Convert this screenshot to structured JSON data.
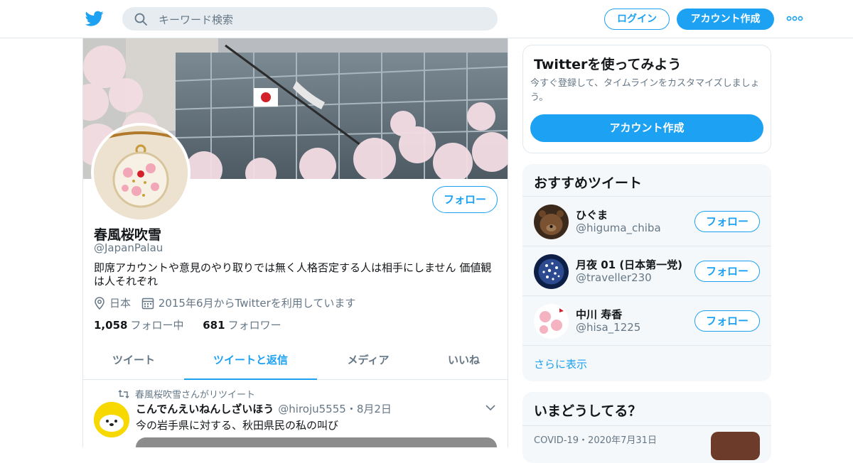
{
  "header": {
    "logo_icon": "twitter-bird-icon",
    "search_placeholder": "キーワード検索",
    "login_label": "ログイン",
    "signup_label": "アカウント作成",
    "more_icon": "more-dots-icon"
  },
  "colors": {
    "accent": "#1da1f2",
    "text_primary": "#14171a",
    "text_secondary": "#657786",
    "border": "#e1e8ed",
    "panel_bg": "#f5f8fa"
  },
  "profile": {
    "name": "春風桜吹雪",
    "handle": "@JapanPalau",
    "follow_label": "フォロー",
    "bio": "即席アカウントや意見のやり取りでは無く人格否定する人は相手にしません 価値観は人それぞれ",
    "location": "日本",
    "joined": "2015年6月からTwitterを利用しています",
    "following_count": "1,058",
    "following_label": "フォロー中",
    "followers_count": "681",
    "followers_label": "フォロワー"
  },
  "tabs": [
    {
      "label": "ツイート"
    },
    {
      "label": "ツイートと返信"
    },
    {
      "label": "メディア"
    },
    {
      "label": "いいね"
    }
  ],
  "active_tab": "ツイートと返信",
  "tweet": {
    "retweet_note": "春風桜吹雪さんがリツイート",
    "author": "こんでんえいねんしざいほう",
    "handle": "@hiroju5555",
    "dot": "・",
    "date": "8月2日",
    "text": "今の岩手県に対する、秋田県民の私の叫び"
  },
  "signup_card": {
    "title": "Twitterを使ってみよう",
    "description": "今すぐ登録して、タイムラインをカスタマイズしましょう。",
    "cta_label": "アカウント作成"
  },
  "recommended": {
    "title": "おすすめツイート",
    "follow_label": "フォロー",
    "users": [
      {
        "name": "ひぐま",
        "handle": "@higuma_chiba"
      },
      {
        "name": "月夜 01 (日本第一党)",
        "handle": "@traveller230"
      },
      {
        "name": "中川 寿香",
        "handle": "@hisa_1225"
      }
    ],
    "show_more": "さらに表示"
  },
  "trends": {
    "title": "いまどうしてる？",
    "first_meta": "COVID-19・2020年7月31日"
  }
}
